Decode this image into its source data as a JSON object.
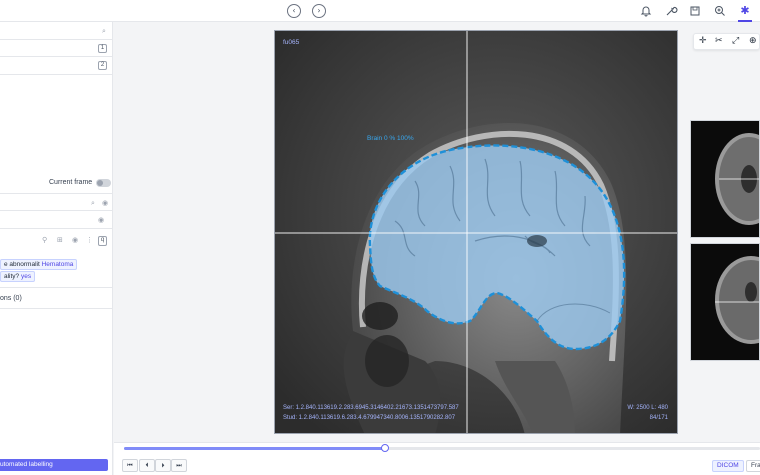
{
  "topbar": {
    "icons": [
      "chevron-left-icon",
      "chevron-right-icon",
      "bell-icon",
      "wrench-icon",
      "save-icon",
      "zoom-icon",
      "asterisk-icon"
    ],
    "accent": "#4f46e5"
  },
  "sidebar": {
    "list_counts": [
      "1",
      "2"
    ],
    "current_frame_label": "Current frame",
    "tag1": {
      "label": "e abnormalit",
      "value": "Hematoma"
    },
    "tag2": {
      "label": "ality?",
      "value": "yes"
    },
    "section_label": "ons (0)",
    "auto_button": "utomated labelling"
  },
  "viewer": {
    "top_left": "fu065",
    "segment_label": "Brain 0 % 100%",
    "bottom_left_1": "Ser: 1.2.840.113619.2.283.6945.3146402.21673.1351473797.587",
    "bottom_left_2": "Stud: 1.2.840.113619.6.283.4.679947340.8006.1351790282.807",
    "bottom_right_1": "W: 2500 L: 480",
    "bottom_right_2": "84/171",
    "mask_color": "#9cc9ef",
    "outline_color": "#1e90d8"
  },
  "bottombar": {
    "progress": 0.41,
    "playback": [
      "⏮",
      "⏴",
      "⏵",
      "⏭"
    ],
    "modes": [
      "DICOM",
      "Fra"
    ]
  }
}
